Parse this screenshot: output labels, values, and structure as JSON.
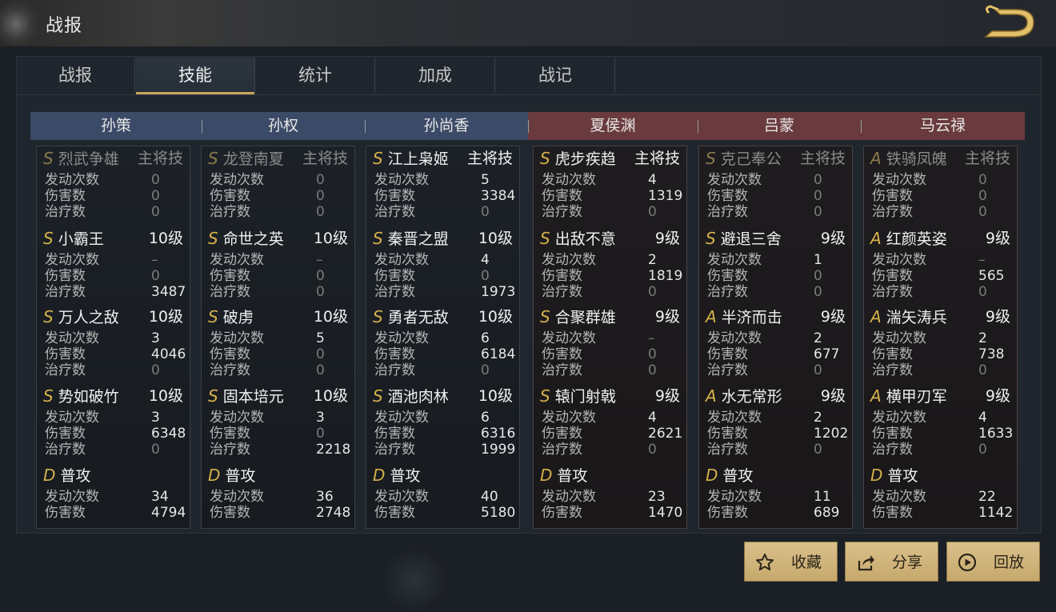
{
  "window": {
    "title": "战报"
  },
  "tabs": [
    {
      "label": "战报"
    },
    {
      "label": "技能"
    },
    {
      "label": "统计"
    },
    {
      "label": "加成"
    },
    {
      "label": "战记"
    }
  ],
  "active_tab": "技能",
  "labels": {
    "trigger": "发动次数",
    "damage": "伤害数",
    "heal": "治疗数"
  },
  "heroes": [
    {
      "name": "孙策",
      "side": "blue",
      "skills": [
        {
          "grade": "S",
          "name": "烈武争雄",
          "level": "主将技",
          "dim": true,
          "trigger": "0",
          "damage": "0",
          "heal": "0"
        },
        {
          "grade": "S",
          "name": "小霸王",
          "level": "10级",
          "trigger": "–",
          "damage": "0",
          "heal": "3487"
        },
        {
          "grade": "S",
          "name": "万人之敌",
          "level": "10级",
          "trigger": "3",
          "damage": "4046",
          "heal": "0"
        },
        {
          "grade": "S",
          "name": "势如破竹",
          "level": "10级",
          "trigger": "3",
          "damage": "6348",
          "heal": "0"
        },
        {
          "grade": "D",
          "name": "普攻",
          "level": "",
          "trigger": "34",
          "damage": "4794"
        }
      ]
    },
    {
      "name": "孙权",
      "side": "blue",
      "skills": [
        {
          "grade": "S",
          "name": "龙登南夏",
          "level": "主将技",
          "dim": true,
          "trigger": "0",
          "damage": "0",
          "heal": "0"
        },
        {
          "grade": "S",
          "name": "命世之英",
          "level": "10级",
          "trigger": "–",
          "damage": "0",
          "heal": "0"
        },
        {
          "grade": "S",
          "name": "破虏",
          "level": "10级",
          "trigger": "5",
          "damage": "0",
          "heal": "0"
        },
        {
          "grade": "S",
          "name": "固本培元",
          "level": "10级",
          "trigger": "3",
          "damage": "0",
          "heal": "2218"
        },
        {
          "grade": "D",
          "name": "普攻",
          "level": "",
          "trigger": "36",
          "damage": "2748"
        }
      ]
    },
    {
      "name": "孙尚香",
      "side": "blue",
      "skills": [
        {
          "grade": "S",
          "name": "江上枭姬",
          "level": "主将技",
          "trigger": "5",
          "damage": "3384",
          "heal": "0"
        },
        {
          "grade": "S",
          "name": "秦晋之盟",
          "level": "10级",
          "trigger": "4",
          "damage": "0",
          "heal": "1973"
        },
        {
          "grade": "S",
          "name": "勇者无敌",
          "level": "10级",
          "trigger": "6",
          "damage": "6184",
          "heal": "0"
        },
        {
          "grade": "S",
          "name": "酒池肉林",
          "level": "10级",
          "trigger": "6",
          "damage": "6316",
          "heal": "1999"
        },
        {
          "grade": "D",
          "name": "普攻",
          "level": "",
          "trigger": "40",
          "damage": "5180"
        }
      ]
    },
    {
      "name": "夏侯渊",
      "side": "red",
      "skills": [
        {
          "grade": "S",
          "name": "虎步疾趋",
          "level": "主将技",
          "trigger": "4",
          "damage": "1319",
          "heal": "0"
        },
        {
          "grade": "S",
          "name": "出敌不意",
          "level": "9级",
          "trigger": "2",
          "damage": "1819",
          "heal": "0"
        },
        {
          "grade": "S",
          "name": "合聚群雄",
          "level": "9级",
          "trigger": "–",
          "damage": "0",
          "heal": "0"
        },
        {
          "grade": "S",
          "name": "辕门射戟",
          "level": "9级",
          "trigger": "4",
          "damage": "2621",
          "heal": "0"
        },
        {
          "grade": "D",
          "name": "普攻",
          "level": "",
          "trigger": "23",
          "damage": "1470"
        }
      ]
    },
    {
      "name": "吕蒙",
      "side": "red",
      "skills": [
        {
          "grade": "S",
          "name": "克己奉公",
          "level": "主将技",
          "dim": true,
          "trigger": "0",
          "damage": "0",
          "heal": "0"
        },
        {
          "grade": "S",
          "name": "避退三舍",
          "level": "9级",
          "trigger": "1",
          "damage": "0",
          "heal": "0"
        },
        {
          "grade": "A",
          "name": "半济而击",
          "level": "9级",
          "trigger": "2",
          "damage": "677",
          "heal": "0"
        },
        {
          "grade": "A",
          "name": "水无常形",
          "level": "9级",
          "trigger": "2",
          "damage": "1202",
          "heal": "0"
        },
        {
          "grade": "D",
          "name": "普攻",
          "level": "",
          "trigger": "11",
          "damage": "689"
        }
      ]
    },
    {
      "name": "马云禄",
      "side": "red",
      "skills": [
        {
          "grade": "A",
          "name": "铁骑凤魄",
          "level": "主将技",
          "dim": true,
          "trigger": "0",
          "damage": "0",
          "heal": "0"
        },
        {
          "grade": "A",
          "name": "红颜英姿",
          "level": "9级",
          "trigger": "–",
          "damage": "565",
          "heal": "0"
        },
        {
          "grade": "A",
          "name": "湍矢涛兵",
          "level": "9级",
          "trigger": "2",
          "damage": "738",
          "heal": "0"
        },
        {
          "grade": "A",
          "name": "横甲刃军",
          "level": "9级",
          "trigger": "4",
          "damage": "1633",
          "heal": "0"
        },
        {
          "grade": "D",
          "name": "普攻",
          "level": "",
          "trigger": "22",
          "damage": "1142"
        }
      ]
    }
  ],
  "buttons": [
    {
      "label": "收藏",
      "icon": "star-icon"
    },
    {
      "label": "分享",
      "icon": "share-icon"
    },
    {
      "label": "回放",
      "icon": "play-icon"
    }
  ],
  "colors": {
    "accent_gold": "#c9a55a",
    "grade_gold": "#d6b24a",
    "blue_team": "#3b4a66",
    "red_team": "#6a3b3e",
    "button": "#d9bf8a"
  }
}
